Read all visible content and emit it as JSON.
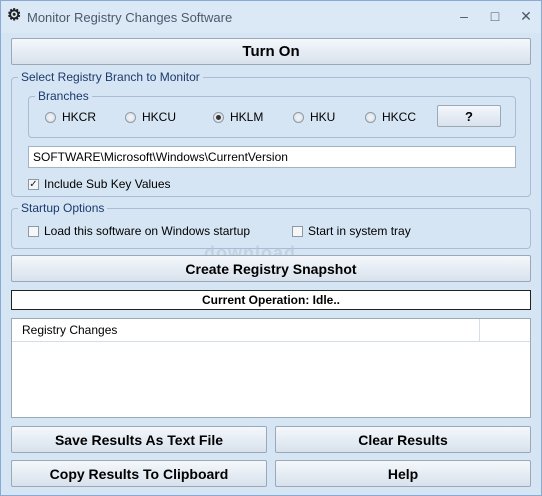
{
  "window": {
    "title": "Monitor Registry Changes Software",
    "minimize": "–",
    "maximize": "□",
    "close": "✕"
  },
  "turn_on_label": "Turn On",
  "branch_group": {
    "title": "Select Registry Branch to Monitor",
    "branches_title": "Branches",
    "branches": [
      {
        "label": "HKCR",
        "checked": false
      },
      {
        "label": "HKCU",
        "checked": false
      },
      {
        "label": "HKLM",
        "checked": true
      },
      {
        "label": "HKU",
        "checked": false
      },
      {
        "label": "HKCC",
        "checked": false
      }
    ],
    "help_label": "?",
    "path_value": "SOFTWARE\\Microsoft\\Windows\\CurrentVersion",
    "include_subkeys_label": "Include Sub Key Values",
    "include_subkeys_checked": true
  },
  "startup": {
    "title": "Startup Options",
    "load_on_startup_label": "Load this software on Windows startup",
    "load_on_startup_checked": false,
    "system_tray_label": "Start in system tray",
    "system_tray_checked": false
  },
  "snapshot_label": "Create Registry Snapshot",
  "status_text": "Current Operation: Idle..",
  "list": {
    "column_header": "Registry Changes"
  },
  "buttons": {
    "save": "Save Results As Text File",
    "clear": "Clear Results",
    "copy": "Copy Results To Clipboard",
    "help": "Help"
  },
  "watermark": "download"
}
